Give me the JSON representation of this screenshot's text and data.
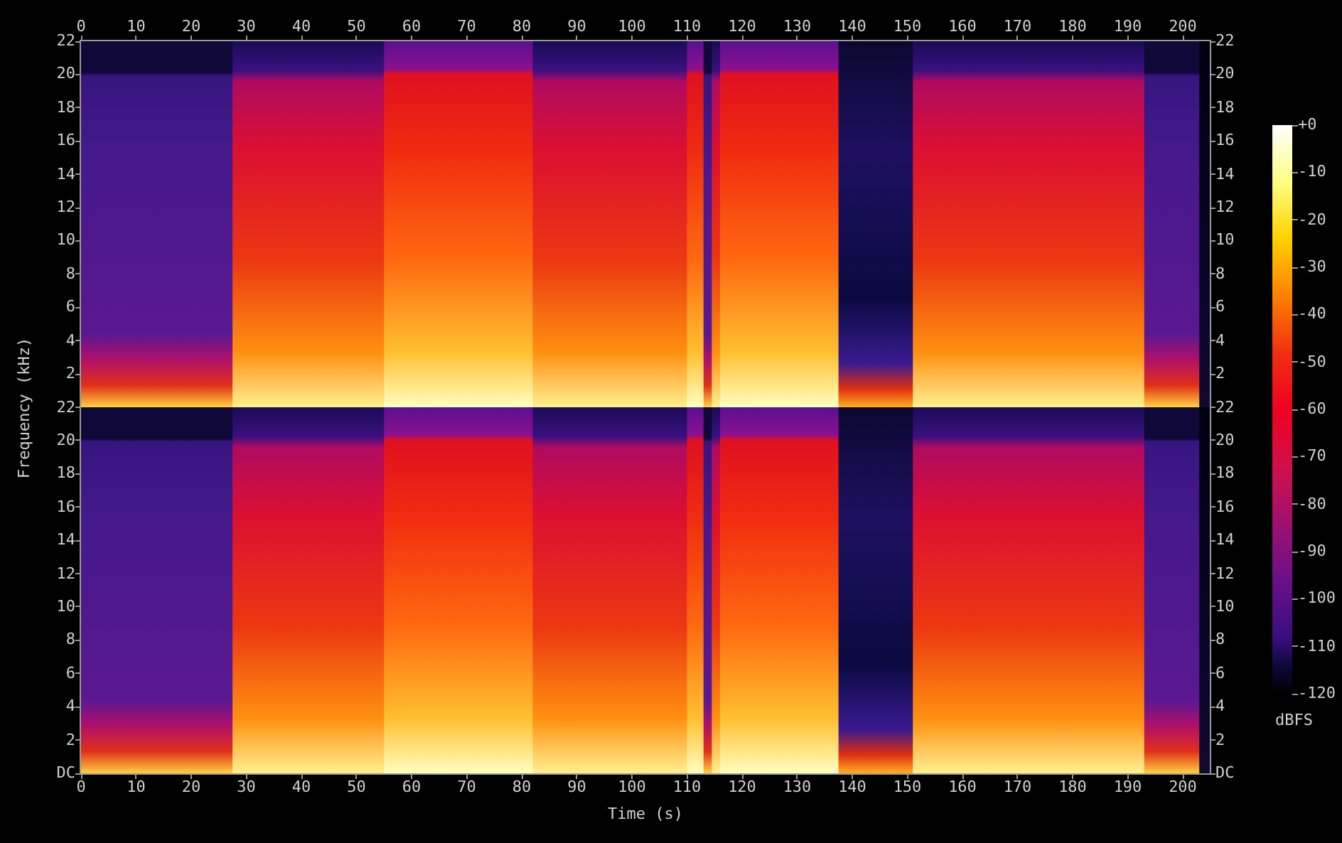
{
  "plot": {
    "ylabel": "Frequency (kHz)",
    "xlabel": "Time (s)",
    "top_time_ticks": [
      "0",
      "10",
      "20",
      "30",
      "40",
      "50",
      "60",
      "70",
      "80",
      "90",
      "100",
      "110",
      "120",
      "130",
      "140",
      "150",
      "160",
      "170",
      "180",
      "190",
      "200"
    ],
    "bottom_time_ticks": [
      "0",
      "10",
      "20",
      "30",
      "40",
      "50",
      "60",
      "70",
      "80",
      "90",
      "100",
      "110",
      "120",
      "130",
      "140",
      "150",
      "160",
      "170",
      "180",
      "190",
      "200"
    ],
    "channels": [
      {
        "left_ticks": [
          "22",
          "20",
          "18",
          "16",
          "14",
          "12",
          "10",
          "8",
          "6",
          "4",
          "2"
        ],
        "right_ticks": [
          "22",
          "20",
          "18",
          "16",
          "14",
          "12",
          "10",
          "8",
          "6",
          "4",
          "2"
        ]
      },
      {
        "left_ticks": [
          "22",
          "20",
          "18",
          "16",
          "14",
          "12",
          "10",
          "8",
          "6",
          "4",
          "2",
          "DC"
        ],
        "right_ticks": [
          "22",
          "20",
          "18",
          "16",
          "14",
          "12",
          "10",
          "8",
          "6",
          "4",
          "2",
          "DC"
        ]
      }
    ]
  },
  "colorbar": {
    "ticks": [
      "+0",
      "-10",
      "-20",
      "-30",
      "-40",
      "-50",
      "-60",
      "-70",
      "-80",
      "-90",
      "-100",
      "-110",
      "-120"
    ],
    "unit": "dBFS"
  }
}
